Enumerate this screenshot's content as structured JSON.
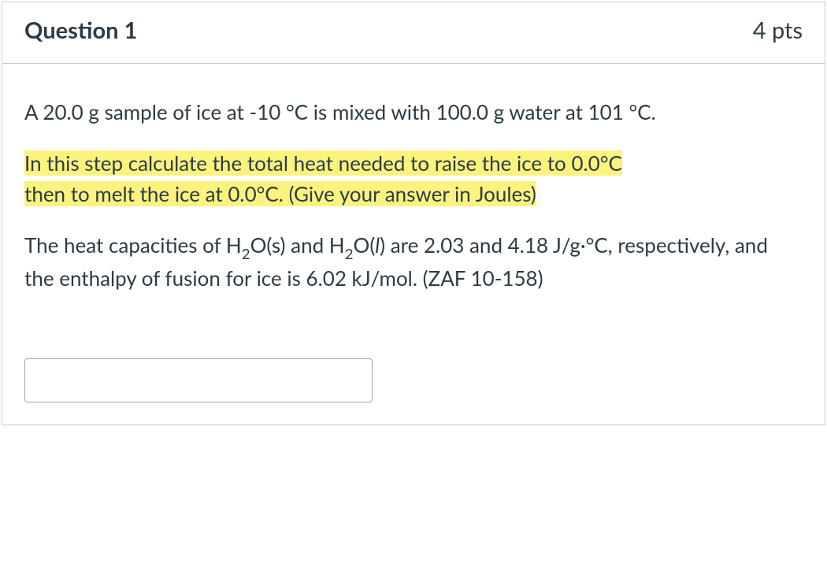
{
  "header": {
    "title": "Question 1",
    "points": "4 pts"
  },
  "body": {
    "p1_a": " A 20.0 g sample of ice at -10 °C is mixed with 100.0 g water at 101 °C.",
    "p2_hl1": "In this step calculate the total heat needed to raise the ice to 0.0°C",
    "p2_hl2": "then to melt the ice at 0.0°C.  (Give your answer in Joules)",
    "p3_a": "The heat capacities of  H",
    "p3_sub1": "2",
    "p3_b": "O(s) and H",
    "p3_sub2": "2",
    "p3_c": "O(",
    "p3_i": "l",
    "p3_d": ") are 2.03 and 4.18 J/g·°C, respectively, and the enthalpy of fusion for ice is 6.02 kJ/mol.   (ZAF 10-158)"
  },
  "answer": {
    "value": ""
  }
}
